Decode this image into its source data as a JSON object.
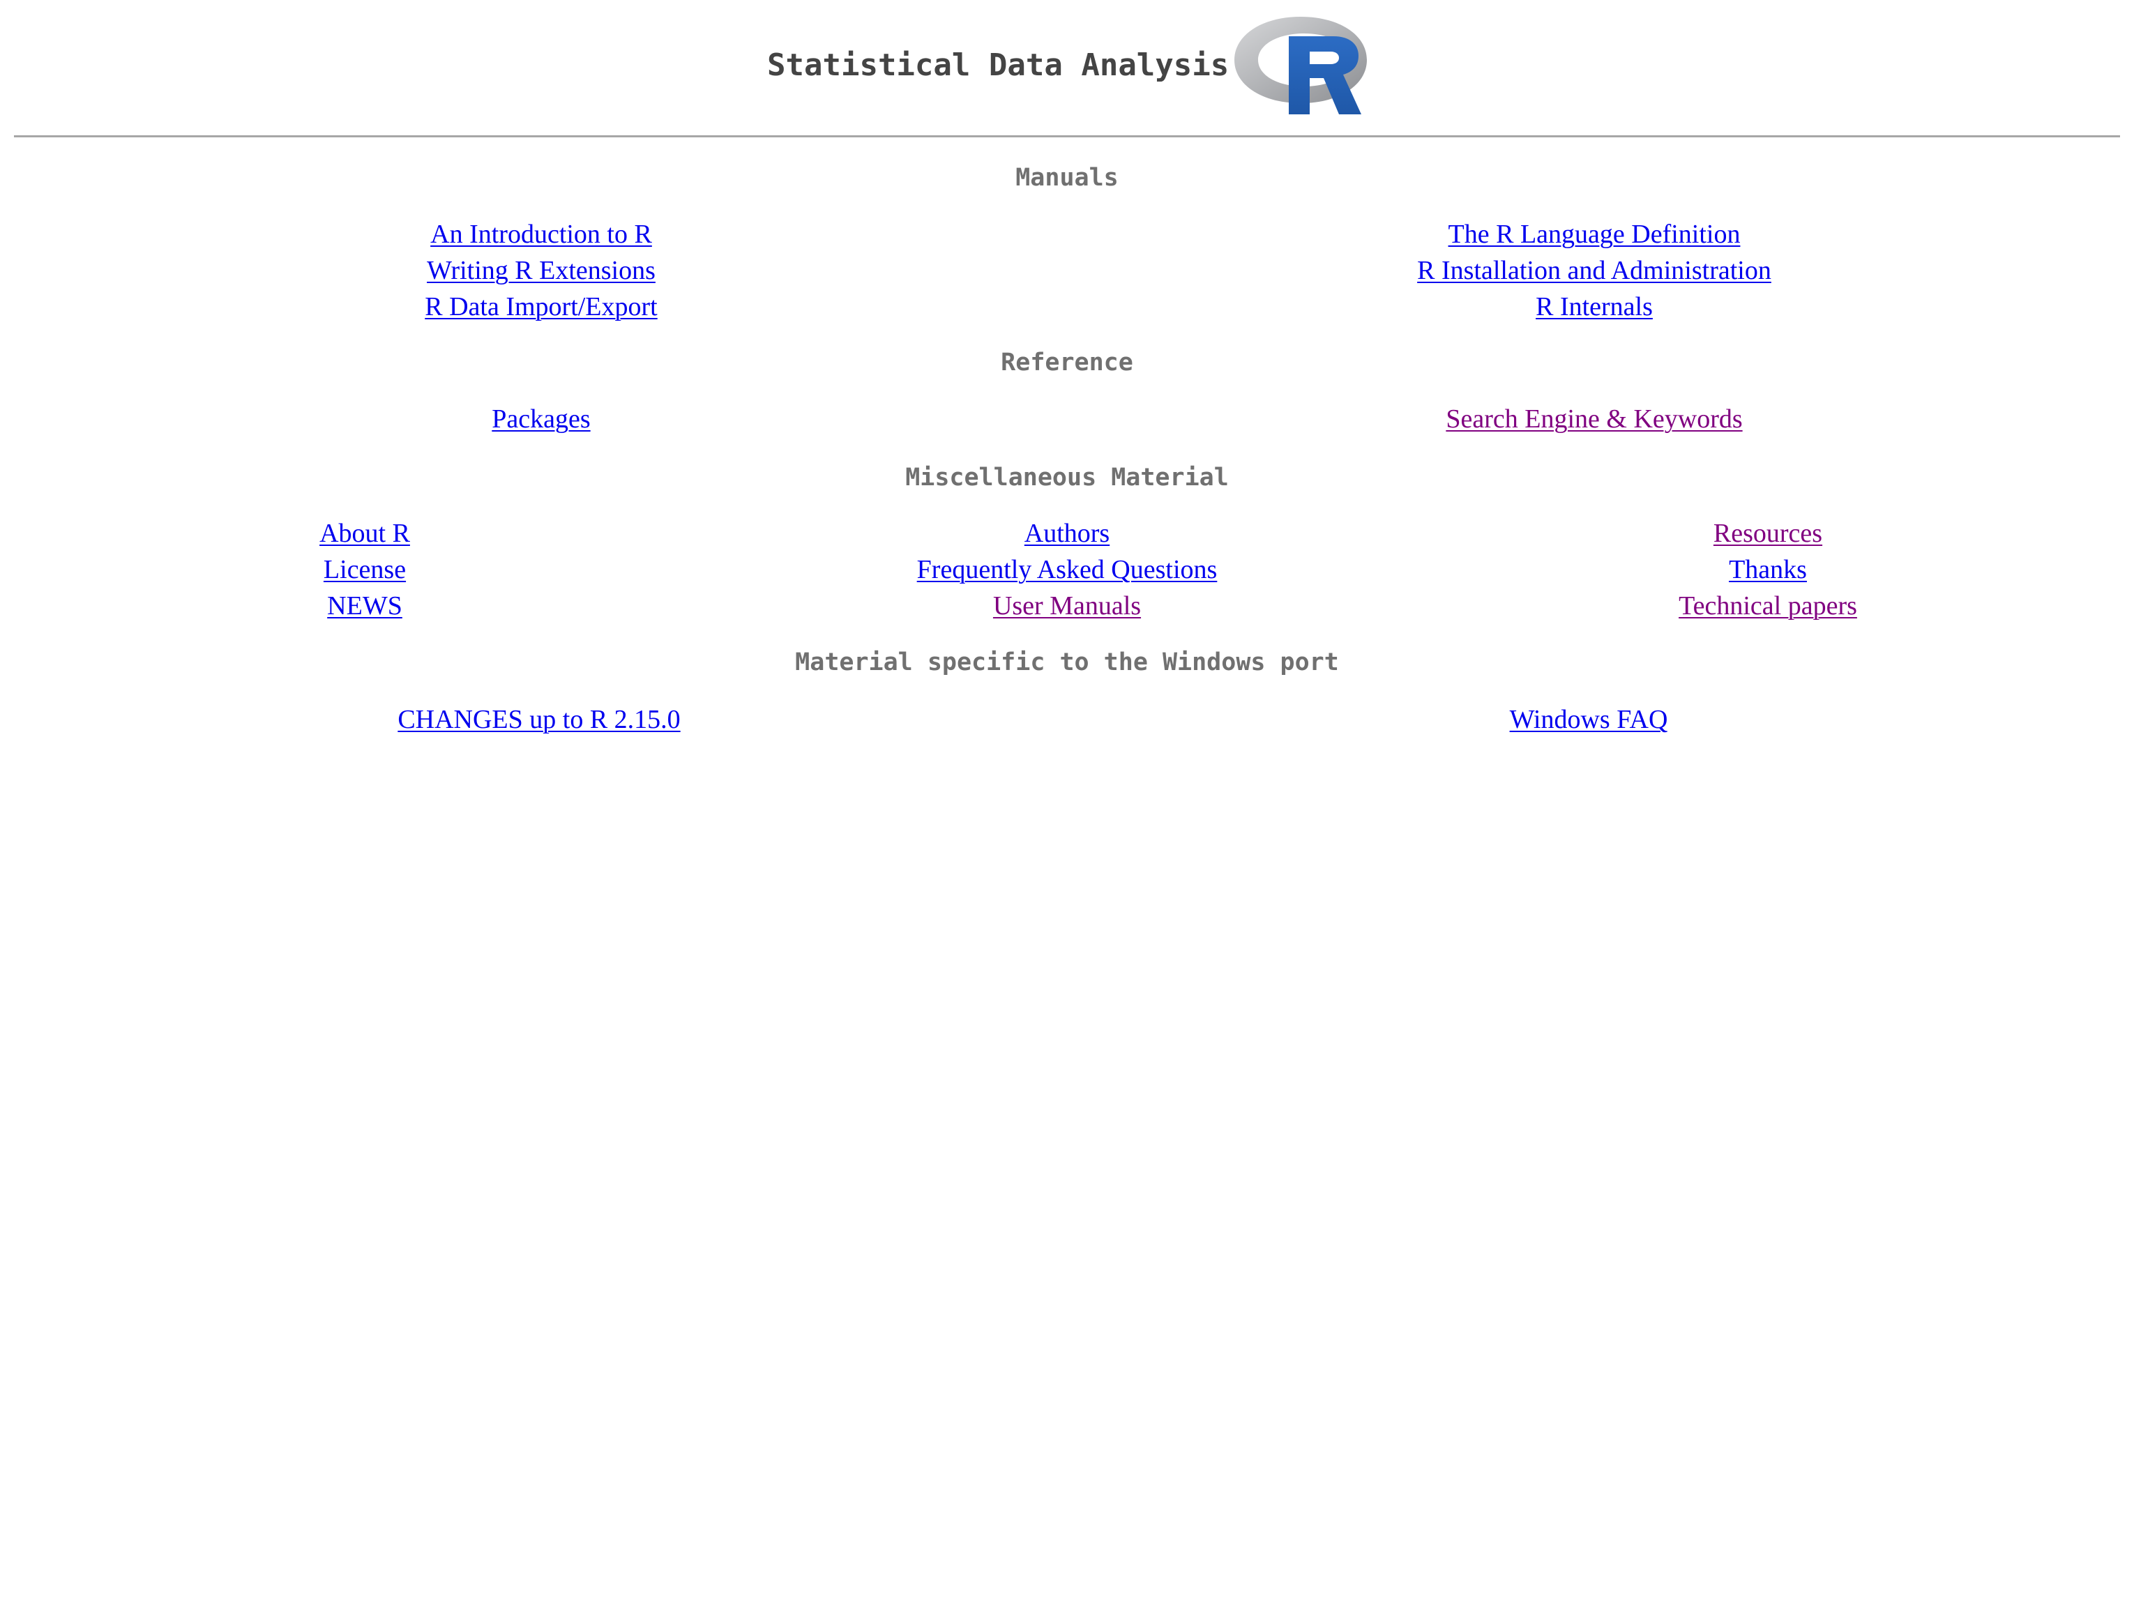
{
  "header": {
    "title": "Statistical Data Analysis",
    "logo_icon": "r-logo-icon",
    "logo_letter": "R"
  },
  "colors": {
    "link": "#0000ee",
    "visited_link": "#800080",
    "heading": "#707070",
    "title": "#444444"
  },
  "sections": {
    "manuals": {
      "heading": "Manuals",
      "left": [
        "An Introduction to R",
        "Writing R Extensions",
        "R Data Import/Export"
      ],
      "right": [
        "The R Language Definition",
        "R Installation and Administration",
        "R Internals"
      ]
    },
    "reference": {
      "heading": "Reference",
      "left": [
        "Packages"
      ],
      "right": [
        "Search Engine & Keywords"
      ]
    },
    "misc": {
      "heading": "Miscellaneous Material",
      "left": [
        "About R",
        "License",
        "NEWS"
      ],
      "middle": [
        "Authors",
        "Frequently Asked Questions",
        "User Manuals"
      ],
      "right": [
        "Resources",
        "Thanks",
        "Technical papers"
      ]
    },
    "windows": {
      "heading": "Material specific to the Windows port",
      "left": [
        "CHANGES up to R 2.15.0"
      ],
      "right": [
        "Windows FAQ"
      ]
    }
  }
}
